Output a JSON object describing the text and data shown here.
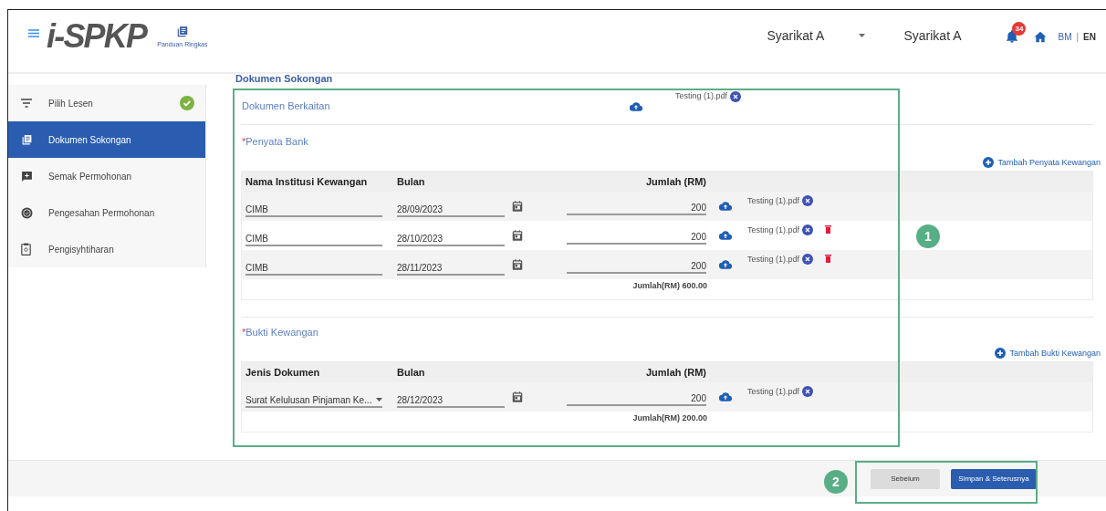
{
  "header": {
    "logo_text": "i-SPKP",
    "guide_label": "Panduan Ringkas",
    "company_selector": "Syarikat A",
    "company_name": "Syarikat A",
    "notification_count": "34",
    "languages": [
      {
        "label": "BM",
        "selected": false
      },
      {
        "label": "EN",
        "selected": true
      }
    ],
    "language_separator": "|"
  },
  "sidebar": {
    "items": [
      {
        "label": "Pilih Lesen",
        "kind": "filter",
        "selected": false,
        "completed": true
      },
      {
        "label": "Dokumen Sokongan",
        "kind": "documents",
        "selected": true,
        "completed": false
      },
      {
        "label": "Semak Permohonan",
        "kind": "review",
        "selected": false,
        "completed": false
      },
      {
        "label": "Pengesahan Permohonan",
        "kind": "verify",
        "selected": false,
        "completed": false
      },
      {
        "label": "Pengisyhtiharan",
        "kind": "clipboard",
        "selected": false,
        "completed": false
      }
    ]
  },
  "page_title": "Dokumen Sokongan",
  "related_document": {
    "label": "Dokumen Berkaitan",
    "file": "Testing (1).pdf"
  },
  "bank_statements": {
    "label": "Penyata Bank",
    "required_mark": "*",
    "add_link": "Tambah Penyata Kewangan",
    "columns": [
      "Nama Institusi Kewangan",
      "Bulan",
      "Jumlah (RM)"
    ],
    "rows": [
      {
        "name": "CIMB",
        "month": "28/09/2023",
        "amount": "200",
        "file": "Testing (1).pdf",
        "deletable": false
      },
      {
        "name": "CIMB",
        "month": "28/10/2023",
        "amount": "200",
        "file": "Testing (1).pdf",
        "deletable": true
      },
      {
        "name": "CIMB",
        "month": "28/11/2023",
        "amount": "200",
        "file": "Testing (1).pdf",
        "deletable": true
      }
    ],
    "total": "Jumlah(RM) 600.00"
  },
  "financial_proof": {
    "label": "Bukti Kewangan",
    "required_mark": "*",
    "add_link": "Tambah Bukti Kewangan",
    "columns": [
      "Jenis Dokumen",
      "Bulan",
      "Jumlah (RM)"
    ],
    "rows": [
      {
        "name": "Surat Kelulusan Pinjaman Ke...",
        "kind": "dropdown",
        "month": "28/12/2023",
        "amount": "200",
        "file": "Testing (1).pdf",
        "deletable": false
      }
    ],
    "total": "Jumlah(RM) 200.00"
  },
  "footer": {
    "buttons": [
      {
        "label": "Sebelum",
        "kind": "secondary"
      },
      {
        "label": "Simpan & Seterusnya",
        "kind": "primary"
      }
    ]
  },
  "callouts": [
    {
      "label": "1"
    },
    {
      "label": "2"
    }
  ]
}
